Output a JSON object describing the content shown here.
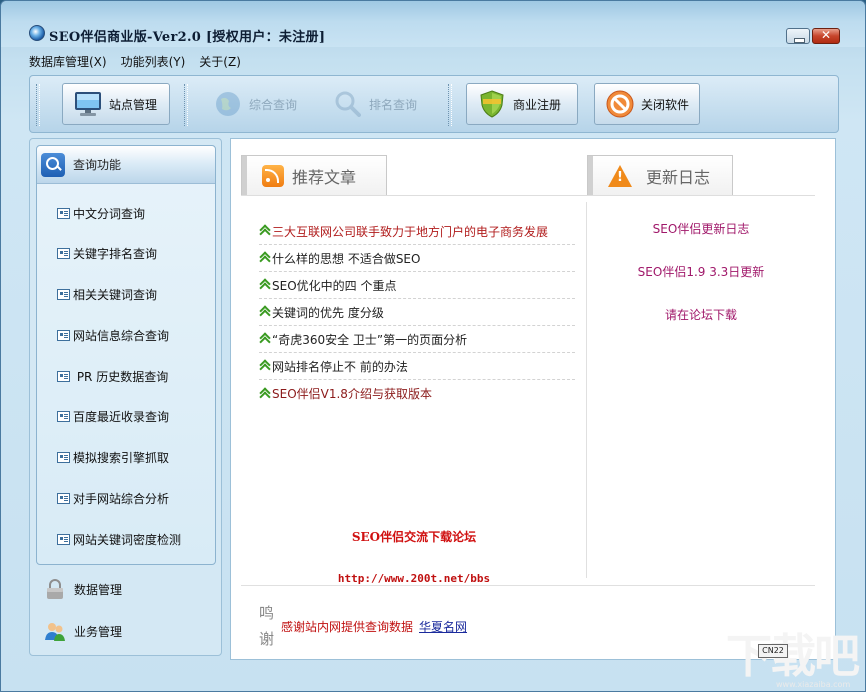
{
  "window": {
    "title": "SEO伴侣商业版-Ver2.0 [授权用户：未注册]"
  },
  "menu": {
    "items": [
      "数据库管理(X)",
      "功能列表(Y)",
      "关于(Z)"
    ]
  },
  "toolbar": {
    "site_manage": "站点管理",
    "comprehensive_query": "综合查询",
    "rank_query": "排名查询",
    "business_register": "商业注册",
    "close_software": "关闭软件"
  },
  "sidebar": {
    "header": "查询功能",
    "items": [
      "中文分词查询",
      "关键字排名查询",
      "相关关键词查询",
      "网站信息综合查询",
      " PR 历史数据查询",
      "百度最近收录查询",
      "模拟搜索引擎抓取",
      "对手网站综合分析",
      "网站关键词密度检测"
    ],
    "data_manage": "数据管理",
    "business_manage": "业务管理"
  },
  "content": {
    "articles_title": "推荐文章",
    "log_title": "更新日志",
    "articles": [
      {
        "text": "三大互联网公司联手致力于地方门户的电子商务发展",
        "style": "red"
      },
      {
        "text": "什么样的思想 不适合做SEO",
        "style": "normal"
      },
      {
        "text": "SEO优化中的四 个重点",
        "style": "normal"
      },
      {
        "text": "关键词的优先 度分级",
        "style": "normal"
      },
      {
        "text": "“奇虎360安全 卫士”第一的页面分析",
        "style": "normal"
      },
      {
        "text": "网站排名停止不 前的办法",
        "style": "normal"
      },
      {
        "text": "SEO伴侣V1.8介绍与获取版本",
        "style": "maroon"
      }
    ],
    "forum_title": "SEO伴侣交流下载论坛",
    "forum_url": "http://www.200t.net/bbs",
    "log": [
      "SEO伴侣更新日志",
      "SEO伴侣1.9 3.3日更新",
      "请在论坛下载"
    ],
    "thanks_label": "鸣谢",
    "thanks_text": "感谢站内网提供查询数据",
    "thanks_link": "华夏名网"
  },
  "watermark": {
    "main": "下载吧",
    "badge": "CN22",
    "url": "www.xiazaiba.com"
  }
}
